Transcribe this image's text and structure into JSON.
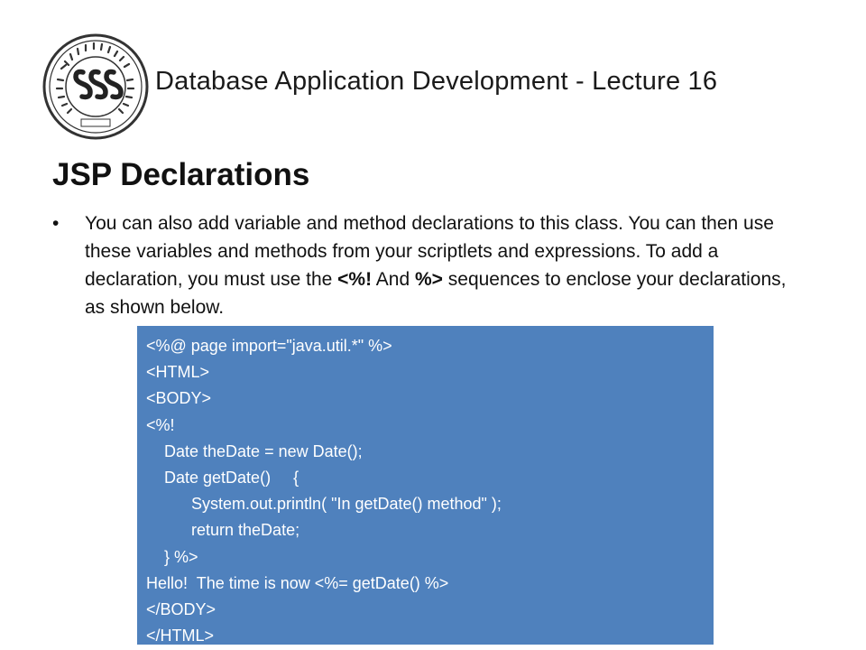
{
  "header": {
    "logo_icon": "university-seal-icon",
    "title": "Database Application Development - Lecture 16"
  },
  "slide": {
    "heading": "JSP Declarations",
    "bullet": {
      "text_before": "You can also add variable and method declarations to this class.  You can then use these variables and methods from your scriptlets and expressions. To add a declaration, you must use the ",
      "bold_open": "<%!",
      "text_middle": " And ",
      "bold_close": "%>",
      "text_after": " sequences to enclose your declarations, as shown below."
    }
  },
  "code": {
    "lines": [
      "<%@ page import=\"java.util.*\" %>",
      "<HTML>",
      "<BODY>",
      "<%!",
      "    Date theDate = new Date();",
      "    Date getDate()     {",
      "          System.out.println( \"In getDate() method\" );",
      "          return theDate;",
      "    } %>",
      "Hello!  The time is now <%= getDate() %>",
      "</BODY>",
      "</HTML>"
    ],
    "background_color": "#4f81bd",
    "text_color": "#ffffff"
  }
}
